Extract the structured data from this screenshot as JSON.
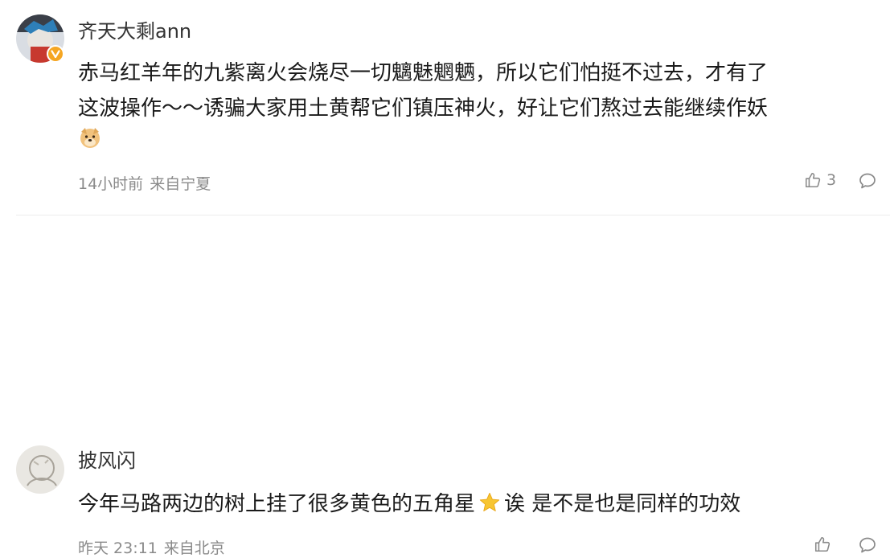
{
  "comments": [
    {
      "username": "齐天大剩ann",
      "lines": [
        "赤马红羊年的九紫离火会烧尽一切魑魅魍魉，所以它们怕挺不过去，才有了",
        "这波操作～～诱骗大家用土黄帮它们镇压神火，好让它们熬过去能继续作妖"
      ],
      "emoji": "doge-emoji",
      "time": "14小时前",
      "location": "来自宁夏",
      "likes": "3",
      "verified_badge": "verified-badge-icon"
    },
    {
      "username": "披风闪",
      "text_before": "今年马路两边的树上挂了很多黄色的五角星",
      "emoji": "star-emoji",
      "text_after": "诶 是不是也是同样的功效",
      "time": "昨天 23:11",
      "location": "来自北京"
    }
  ],
  "colors": {
    "username": "#333333",
    "text": "#1a1a1a",
    "meta": "#8a8a8a",
    "badge": "#f5a623"
  }
}
